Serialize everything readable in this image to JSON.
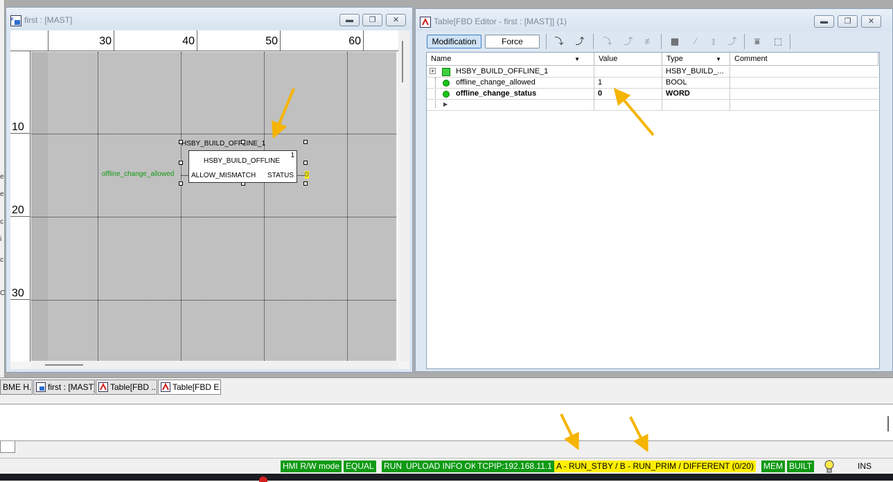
{
  "fbd_window": {
    "title": "first : [MAST]",
    "ruler_top": [
      "30",
      "40",
      "50",
      "60"
    ],
    "ruler_left": [
      "10",
      "20",
      "30"
    ],
    "block": {
      "instance_name": "HSBY_BUILD_OFFLINE_1",
      "type_name": "HSBY_BUILD_OFFLINE",
      "exec_order": "1",
      "input_pin": "ALLOW_MISMATCH",
      "output_pin": "STATUS",
      "input_variable": "offline_change_allowed",
      "output_value": "0"
    }
  },
  "table_window": {
    "title": "Table[FBD Editor - first : [MAST]] (1)",
    "toolbar": {
      "modification_label": "Modification",
      "force_label": "Force"
    },
    "columns": [
      "Name",
      "Value",
      "Type",
      "Comment"
    ],
    "rows": [
      {
        "name": "HSBY_BUILD_OFFLINE_1",
        "value": "",
        "type": "HSBY_BUILD_...",
        "comment": ""
      },
      {
        "name": "offline_change_allowed",
        "value": "1",
        "type": "BOOL",
        "comment": ""
      },
      {
        "name": "offline_change_status",
        "value": "0",
        "type": "WORD",
        "comment": ""
      }
    ]
  },
  "tabs": [
    "BME H...",
    "first : [MAST]",
    "Table[FBD ...",
    "Table[FBD E..."
  ],
  "status_bar": {
    "hmi_mode": "HMI R/W mode",
    "equal": "EQUAL",
    "run": "RUN",
    "upload_info": "UPLOAD INFO OK",
    "tcpip": "TCPIP:192.168.11.1",
    "redundancy": "A - RUN_STBY / B - RUN_PRIM / DIFFERENT (0/20)",
    "mem": "MEM",
    "built": "BUILT",
    "ins": "INS"
  },
  "left_strip_chars": [
    "e",
    "e",
    "c",
    "i",
    "c",
    "C"
  ],
  "colors": {
    "accent_green": "#0f9a14",
    "highlight_yellow": "#ffee00",
    "annotation_arrow": "#f5b400"
  }
}
